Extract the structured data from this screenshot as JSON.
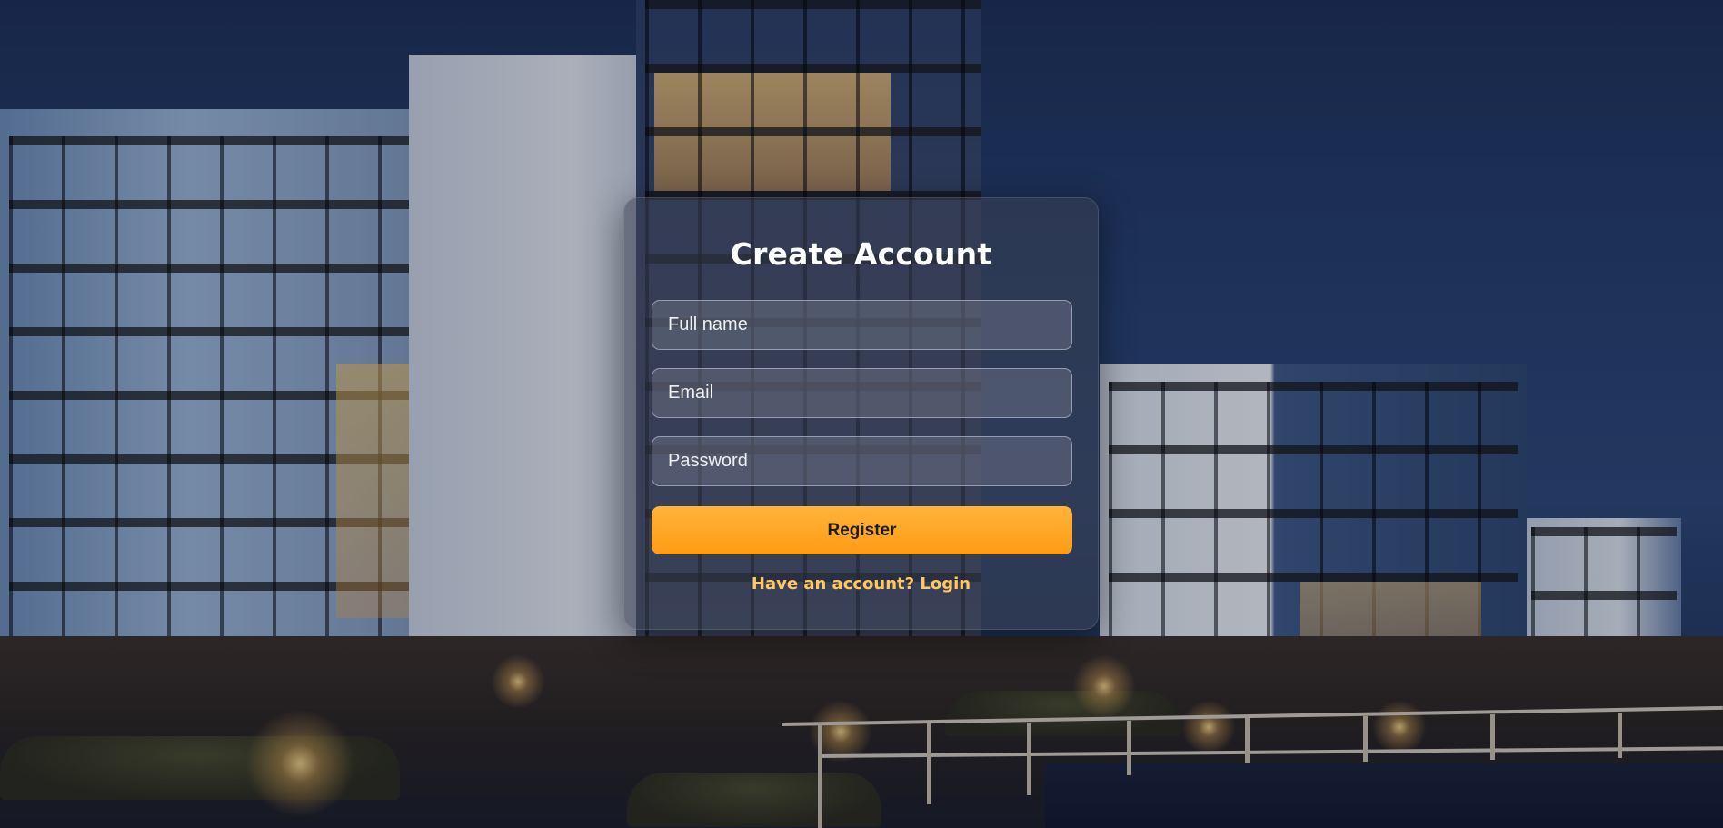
{
  "form": {
    "title": "Create Account",
    "fullname_placeholder": "Full name",
    "email_placeholder": "Email",
    "password_placeholder": "Password",
    "register_label": "Register",
    "login_prompt": "Have an account?",
    "login_link": "Login"
  },
  "colors": {
    "accent": "#ff9f1c",
    "link": "#ffc766",
    "card": "#3c4252"
  }
}
